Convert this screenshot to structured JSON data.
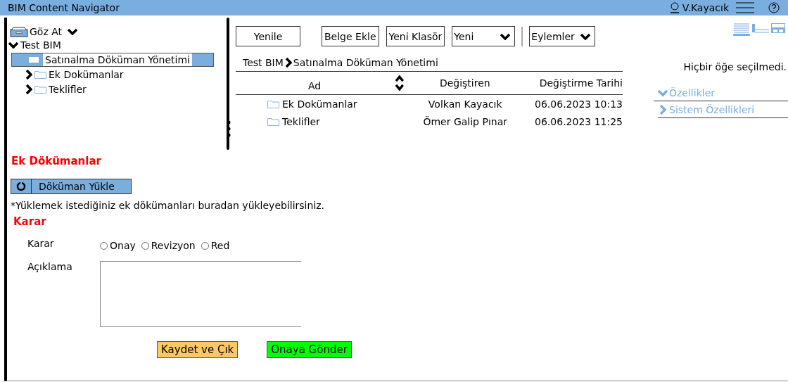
{
  "window": {
    "title": "BIM Content Navigator"
  },
  "user": {
    "name": "V.Kayacık"
  },
  "browse": {
    "label": "Göz At"
  },
  "tree": [
    {
      "label": "Test BIM",
      "expanded": true,
      "selected": false,
      "children": [
        {
          "label": "Satınalma Döküman Yönetimi",
          "selected": true,
          "children": [
            {
              "label": "Ek Dokümanlar",
              "expanded": false,
              "selected": false
            },
            {
              "label": "Teklifler",
              "expanded": false,
              "selected": false
            }
          ]
        }
      ]
    }
  ],
  "toolbar": [
    {
      "label": "Yenile",
      "kind": "button"
    },
    {
      "label": "Belge Ekle",
      "kind": "button"
    },
    {
      "label": "Yeni Klasör",
      "kind": "button"
    },
    {
      "label": "Yeni",
      "kind": "dropdown"
    },
    {
      "label": "Eylemler",
      "kind": "dropdown"
    }
  ],
  "breadcrumb": [
    "Test BIM",
    "Satınalma Döküman Yönetimi"
  ],
  "table": {
    "columns": [
      "Ad",
      "Değiştiren",
      "Değiştirme Tarihi"
    ],
    "rows": [
      {
        "name": "Ek Dokümanlar",
        "modified_by": "Volkan Kayacık",
        "modified": "06.06.2023 10:13"
      },
      {
        "name": "Teklifler",
        "modified_by": "Ömer Galip Pınar",
        "modified": "06.06.2023 11:25"
      }
    ]
  },
  "details": {
    "message": "Hiçbir öğe seçilmedi.",
    "sections": [
      {
        "label": "Özellikler",
        "expanded": true
      },
      {
        "label": "Sistem Özellikleri",
        "expanded": false
      }
    ]
  },
  "attachments": {
    "title": "Ek Dökümanlar",
    "upload_button": "Döküman Yükle",
    "hint": "*Yüklemek istediğiniz ek dökümanları buradan yükleyebilirsiniz."
  },
  "decision": {
    "title": "Karar",
    "label": "Karar",
    "options": [
      {
        "label": "Onay",
        "selected": false
      },
      {
        "label": "Revizyon",
        "selected": false
      },
      {
        "label": "Red",
        "selected": false
      }
    ],
    "comment_label": "Açıklama"
  },
  "actions": [
    {
      "label": "Kaydet ve Çık",
      "color": "#ffc864"
    },
    {
      "label": "Onaya Gönder",
      "color": "#00ff00"
    }
  ]
}
